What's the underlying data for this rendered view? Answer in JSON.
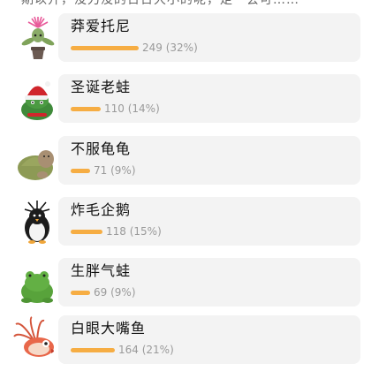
{
  "header": {
    "partial_text": "期以开，没刀没的日日大小的呢，走一会可……"
  },
  "colors": {
    "bar": "#f6ad43",
    "card_bg": "#f3f3f3",
    "stat_text": "#9a9a9a"
  },
  "items": [
    {
      "name": "莽爱托尼",
      "votes": "249",
      "percent": "(32%)",
      "share": 0.32,
      "icon": "thistle-plant-plush-icon"
    },
    {
      "name": "圣诞老蛙",
      "votes": "110",
      "percent": "(14%)",
      "share": 0.14,
      "icon": "santa-frog-plush-icon"
    },
    {
      "name": "不服龟龟",
      "votes": "71",
      "percent": "(9%)",
      "share": 0.09,
      "icon": "turtle-plush-icon"
    },
    {
      "name": "炸毛企鹅",
      "votes": "118",
      "percent": "(15%)",
      "share": 0.15,
      "icon": "fluffy-penguin-plush-icon"
    },
    {
      "name": "生胖气蛙",
      "votes": "69",
      "percent": "(9%)",
      "share": 0.09,
      "icon": "chubby-frog-plush-icon"
    },
    {
      "name": "白眼大嘴鱼",
      "votes": "164",
      "percent": "(21%)",
      "share": 0.21,
      "icon": "lionfish-plush-icon"
    }
  ]
}
